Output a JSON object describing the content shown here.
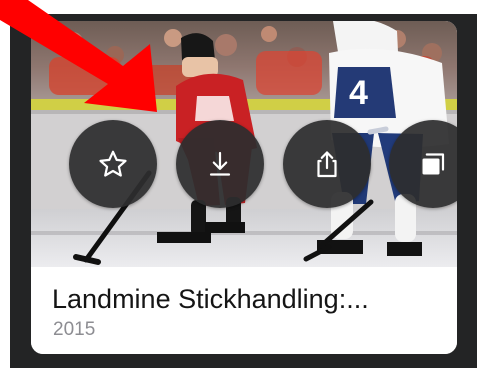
{
  "card": {
    "title": "Landmine Stickhandling:...",
    "year": "2015"
  },
  "actions": [
    {
      "id": "favorite",
      "label": "",
      "icon": "star-icon"
    },
    {
      "id": "download",
      "label": "",
      "icon": "download-icon"
    },
    {
      "id": "share",
      "label": "",
      "icon": "share-icon"
    },
    {
      "id": "picture-in-picture",
      "label": "",
      "icon": "picture-in-picture-icon"
    }
  ],
  "colors": {
    "annotation_arrow": "#ff0000",
    "card_background": "#ffffff",
    "title_text": "#151515",
    "year_text": "#8d8d92",
    "button_background": "#2d2d2e"
  }
}
